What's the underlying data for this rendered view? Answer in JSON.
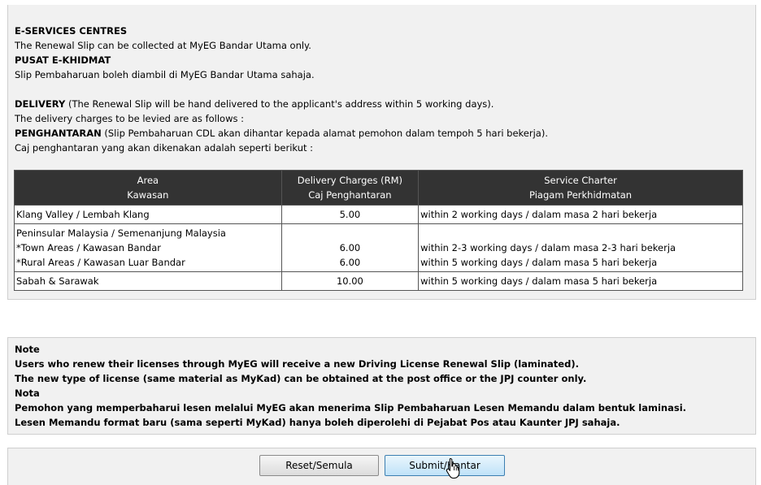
{
  "eservices": {
    "heading_en": "E-SERVICES CENTRES",
    "text_en": "The Renewal Slip can be collected at MyEG Bandar Utama only.",
    "heading_ms": "PUSAT E-KHIDMAT",
    "text_ms": "Slip Pembaharuan boleh diambil di MyEG Bandar Utama sahaja."
  },
  "delivery": {
    "heading_en": "DELIVERY",
    "text_en": " (The Renewal Slip will be hand delivered to the applicant's address within 5 working days).",
    "charges_en": "The delivery charges to be levied are as follows :",
    "heading_ms": "PENGHANTARAN",
    "text_ms": " (Slip Pembaharuan CDL akan dihantar kepada alamat pemohon dalam tempoh 5 hari bekerja).",
    "charges_ms": "Caj penghantaran yang akan dikenakan adalah seperti berikut :"
  },
  "table": {
    "headers": [
      {
        "en": "Area",
        "ms": "Kawasan"
      },
      {
        "en": "Delivery Charges (RM)",
        "ms": "Caj Penghantaran"
      },
      {
        "en": "Service Charter",
        "ms": "Piagam Perkhidmatan"
      }
    ],
    "row1": {
      "area": "Klang Valley / Lembah Klang",
      "charge": "5.00",
      "charter": "within 2 working days / dalam masa 2 hari bekerja"
    },
    "row2": {
      "area_title": "Peninsular Malaysia / Semenanjung Malaysia",
      "town": "*Town Areas / Kawasan Bandar",
      "town_charge": "6.00",
      "town_charter": "within 2-3 working days / dalam masa 2-3 hari bekerja",
      "rural": "*Rural Areas / Kawasan Luar Bandar",
      "rural_charge": "6.00",
      "rural_charter": "within 5 working days / dalam masa 5 hari bekerja"
    },
    "row3": {
      "area": "Sabah & Sarawak",
      "charge": "10.00",
      "charter": "within 5 working days / dalam masa 5 hari bekerja"
    }
  },
  "note": {
    "heading_en": "Note",
    "line1_en": "Users who renew their licenses through MyEG will receive a new Driving License Renewal Slip (laminated).",
    "line2_en": "The new type of license (same material as MyKad) can be obtained at the post office or the JPJ counter only.",
    "heading_ms": "Nota",
    "line1_ms": "Pemohon yang memperbaharui lesen melalui MyEG akan menerima Slip Pembaharuan Lesen Memandu dalam bentuk laminasi.",
    "line2_ms": "Lesen Memandu format baru (sama seperti MyKad) hanya boleh diperolehi di Pejabat Pos atau Kaunter JPJ sahaja."
  },
  "buttons": {
    "reset_label": "Reset/Semula",
    "submit_label": "Submit/Hantar"
  }
}
